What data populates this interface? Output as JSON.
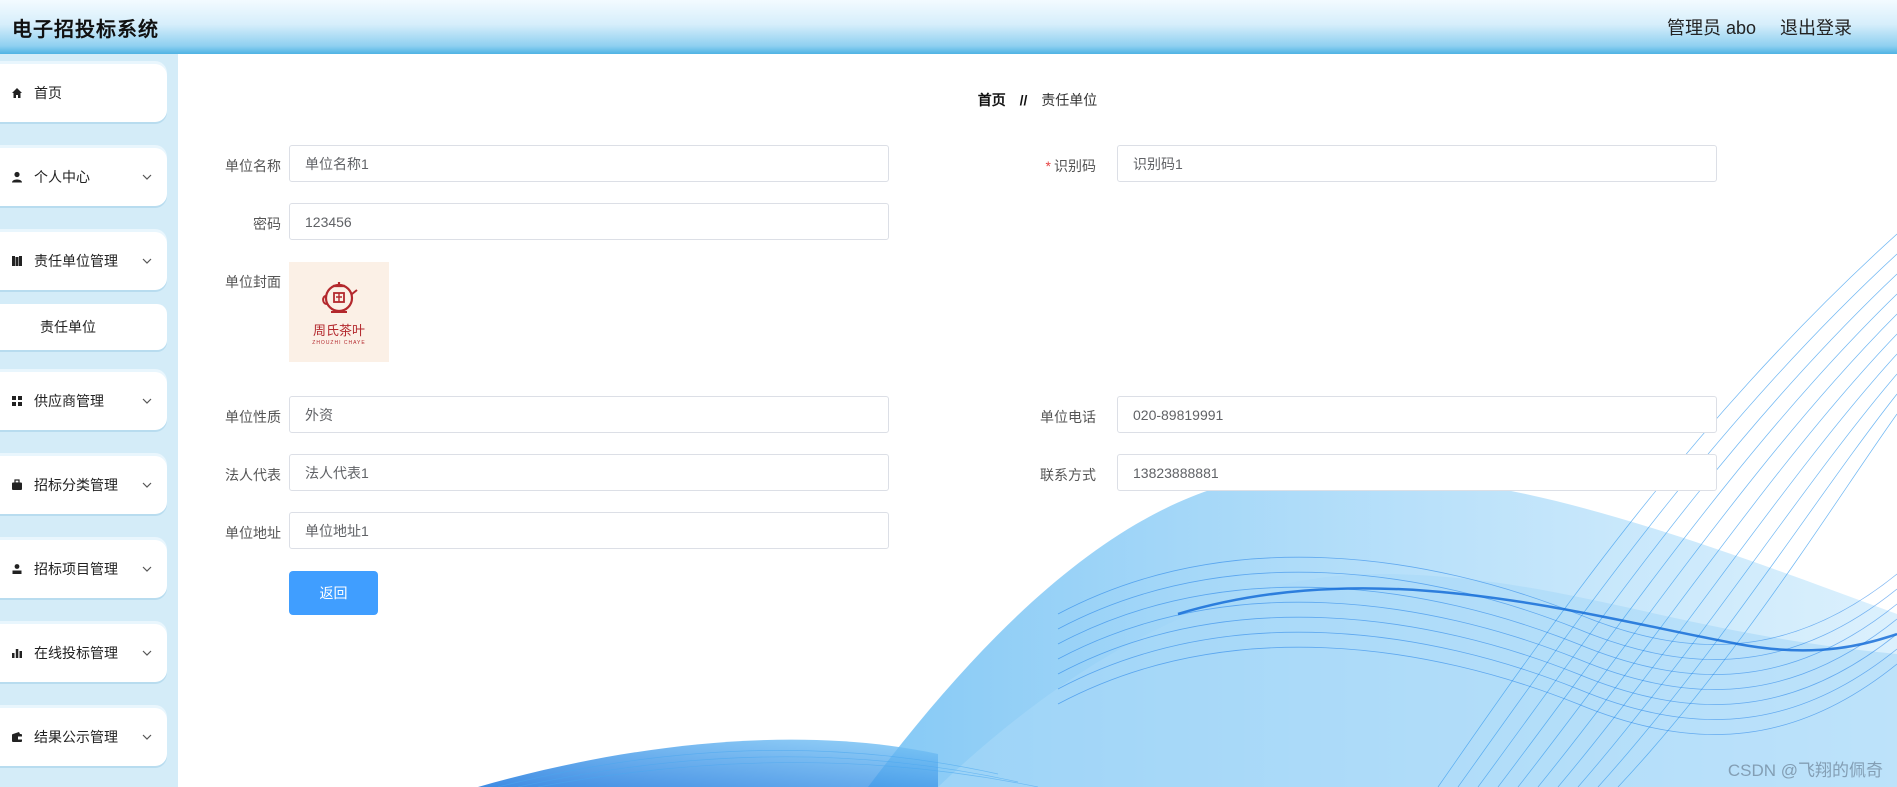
{
  "header": {
    "app_title": "电子招投标系统",
    "user_label": "管理员 abo",
    "logout_label": "退出登录"
  },
  "sidebar": {
    "items": [
      {
        "label": "首页",
        "icon": "home-icon"
      },
      {
        "label": "个人中心",
        "icon": "user-icon"
      },
      {
        "label": "责任单位管理",
        "icon": "book-icon"
      },
      {
        "label": "供应商管理",
        "icon": "grid-icon"
      },
      {
        "label": "招标分类管理",
        "icon": "briefcase-icon"
      },
      {
        "label": "招标项目管理",
        "icon": "person-icon"
      },
      {
        "label": "在线投标管理",
        "icon": "bar-chart-icon"
      },
      {
        "label": "结果公示管理",
        "icon": "wallet-icon"
      }
    ],
    "sub_item": {
      "label": "责任单位"
    }
  },
  "breadcrumb": {
    "home": "首页",
    "separator": "//",
    "current": "责任单位"
  },
  "form": {
    "unit_name": {
      "label": "单位名称",
      "value": "单位名称1"
    },
    "identifier": {
      "label": "识别码",
      "required_mark": "*",
      "value": "识别码1"
    },
    "password": {
      "label": "密码",
      "value": "123456"
    },
    "cover": {
      "label": "单位封面",
      "logo_text": "周氏茶叶",
      "logo_subtext": "ZHOUZHI CHAYE"
    },
    "nature": {
      "label": "单位性质",
      "value": "外资"
    },
    "phone": {
      "label": "单位电话",
      "value": "020-89819991"
    },
    "legal_rep": {
      "label": "法人代表",
      "value": "法人代表1"
    },
    "contact": {
      "label": "联系方式",
      "value": "13823888881"
    },
    "address": {
      "label": "单位地址",
      "value": "单位地址1"
    },
    "back_button": "返回"
  },
  "watermark": "CSDN @飞翔的佩奇",
  "colors": {
    "primary_button": "#409eff",
    "sidebar_bg": "#d4ecf8",
    "required": "#e64242",
    "wave_blue": "#1d7ee8"
  }
}
